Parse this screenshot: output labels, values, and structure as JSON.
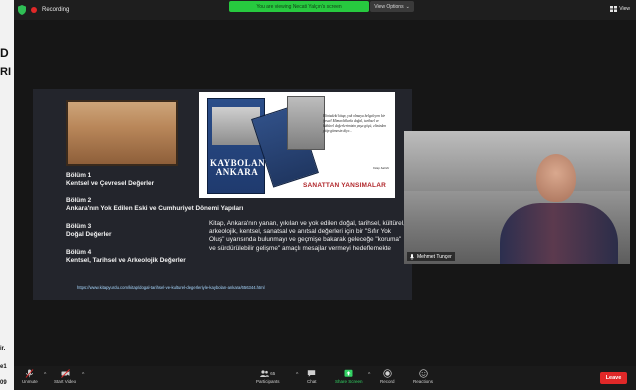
{
  "topbar": {
    "recording_label": "Recording",
    "viewing_banner": "You are viewing Necati Yalçın's screen",
    "view_options_label": "View Options",
    "view_label": "View"
  },
  "left_strip": {
    "fragments": [
      "D",
      "RI",
      "ir.",
      "e1",
      "09"
    ]
  },
  "slide": {
    "book_title": "KAYBOLAN ANKARA",
    "book_caption": "SANATTAN YANSIMALAR",
    "quote_text": "Elinizdeki kitap, yok olmaya belgeleyen bir fırsat! Mimarlıklarla doğal, tarihsel ve kültürel değerlerimizin yaşa göçü, elinizden yitip gitmesin diye...",
    "quote_author": "Kitap Sahibi",
    "sections": [
      {
        "title": "Bölüm 1",
        "subtitle": "Kentsel ve Çevresel Değerler"
      },
      {
        "title": "Bölüm 2",
        "subtitle": "Ankara'nın Yok Edilen Eski ve Cumhuriyet Dönemi Yapıları"
      },
      {
        "title": "Bölüm 3",
        "subtitle": "Doğal Değerler"
      },
      {
        "title": "Bölüm 4",
        "subtitle": "Kentsel, Tarihsel ve Arkeolojik Değerler"
      }
    ],
    "description": "Kitap, Ankara'nın yanan, yıkılan ve yok edilen doğal, tarihsel, kültürel, arkeolojik, kentsel, sanatsal ve anıtsal değerleri için bir \"Sıfır Yok Oluş\" uyarısında bulunmayı ve geçmişe bakarak geleceğe \"koruma\" ve sürdürülebilir gelişme\" amaçlı mesajlar vermeyi hedeflemekte",
    "url": "https://www.kitapyurdu.com/kitap/dogal-tarihsel-ve-kulturel-degerleriyle-kaybolan-ankara/656344.html"
  },
  "video": {
    "participant_name": "Mehmet Tunçer"
  },
  "toolbar": {
    "unmute_label": "Unmute",
    "start_video_label": "Start Video",
    "participants_label": "Participants",
    "participants_count": "65",
    "chat_label": "Chat",
    "share_screen_label": "Share Screen",
    "record_label": "Record",
    "reactions_label": "Reactions",
    "leave_label": "Leave"
  },
  "colors": {
    "banner_green": "#27c93f",
    "leave_red": "#e02828",
    "slide_background": "#23252c"
  }
}
